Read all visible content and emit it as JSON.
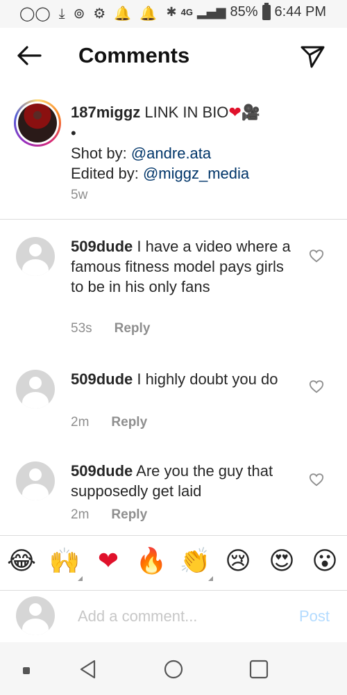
{
  "status_bar": {
    "left_icons": [
      "voicemail-icon",
      "download-icon",
      "hotspot-icon",
      "settings-icon",
      "bell-icon",
      "bell-icon"
    ],
    "network": "4G",
    "battery": "85%",
    "time": "6:44 PM"
  },
  "header": {
    "title": "Comments"
  },
  "caption": {
    "username": "187miggz",
    "text": "LINK IN BIO",
    "bullet": "•",
    "shot_by_label": "Shot by:",
    "shot_by_handle": "@andre.ata",
    "edited_by_label": "Edited by:",
    "edited_by_handle": "@miggz_media",
    "time": "5w"
  },
  "comments": [
    {
      "username": "509dude",
      "text": "I have a video where a famous fitness model pays girls to be in his only fans",
      "time": "53s",
      "reply_label": "Reply"
    },
    {
      "username": "509dude",
      "text": "I highly doubt you do",
      "time": "2m",
      "reply_label": "Reply"
    },
    {
      "username": "509dude",
      "text": "Are you the guy that supposedly get laid",
      "time": "2m",
      "reply_label": "Reply"
    }
  ],
  "emoji_bar": [
    "😂",
    "🙌",
    "❤",
    "🔥",
    "👏",
    "😢",
    "😍",
    "😮"
  ],
  "composer": {
    "placeholder": "Add a comment...",
    "post_label": "Post"
  },
  "colors": {
    "mention": "#003569",
    "post_disabled": "#b3dbff",
    "meta_gray": "#8e8e8e"
  }
}
